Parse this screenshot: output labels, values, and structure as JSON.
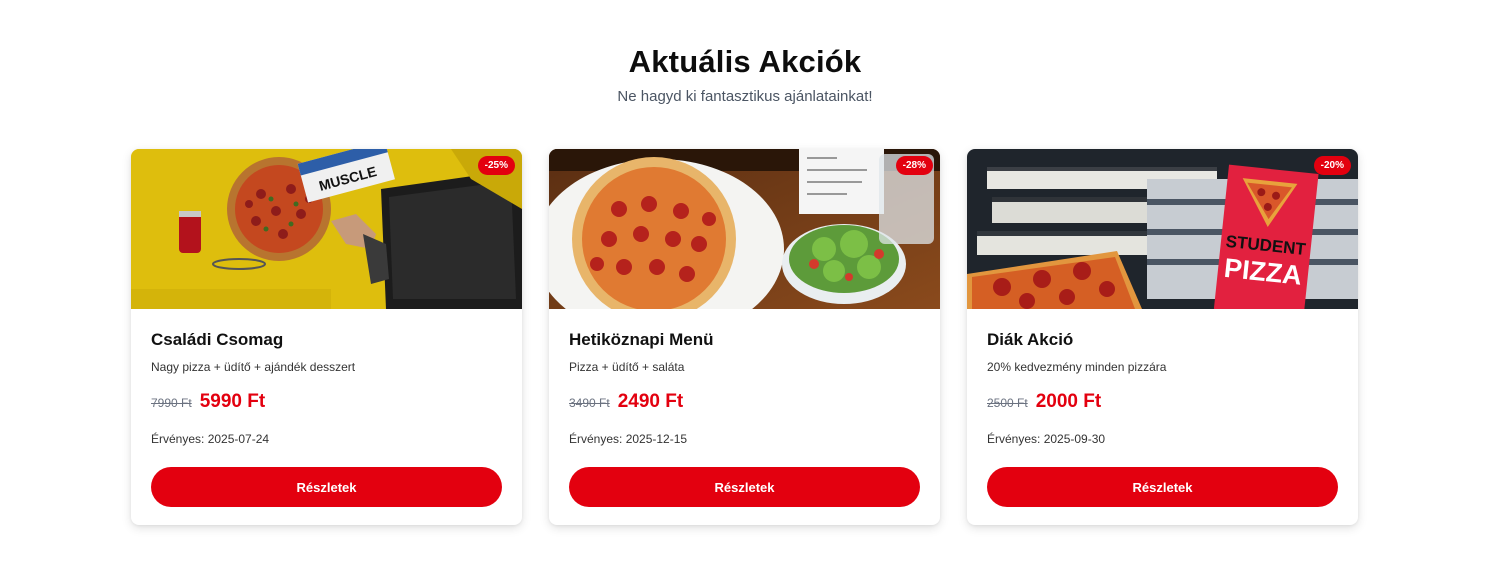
{
  "header": {
    "title": "Aktuális Akciók",
    "subtitle": "Ne hagyd ki fantasztikus ajánlatainkat!"
  },
  "cards": [
    {
      "badge": "-25%",
      "title": "Családi Csomag",
      "description": "Nagy pizza + üdítő + ajándék desszert",
      "old_price": "7990 Ft",
      "new_price": "5990 Ft",
      "validity": "Érvényes: 2025-07-24",
      "button_label": "Részletek",
      "image_magazine_text": "MUSCLE"
    },
    {
      "badge": "-28%",
      "title": "Hetiköznapi Menü",
      "description": "Pizza + üdítő + saláta",
      "old_price": "3490 Ft",
      "new_price": "2490 Ft",
      "validity": "Érvényes: 2025-12-15",
      "button_label": "Részletek"
    },
    {
      "badge": "-20%",
      "title": "Diák Akció",
      "description": "20% kedvezmény minden pizzára",
      "old_price": "2500 Ft",
      "new_price": "2000 Ft",
      "validity": "Érvényes: 2025-09-30",
      "button_label": "Részletek",
      "image_poster_line1": "STUDENT",
      "image_poster_line2": "PIZZA"
    }
  ],
  "colors": {
    "accent": "#e3000f",
    "title": "#0d0d0d",
    "subtitle": "#4b5563"
  }
}
